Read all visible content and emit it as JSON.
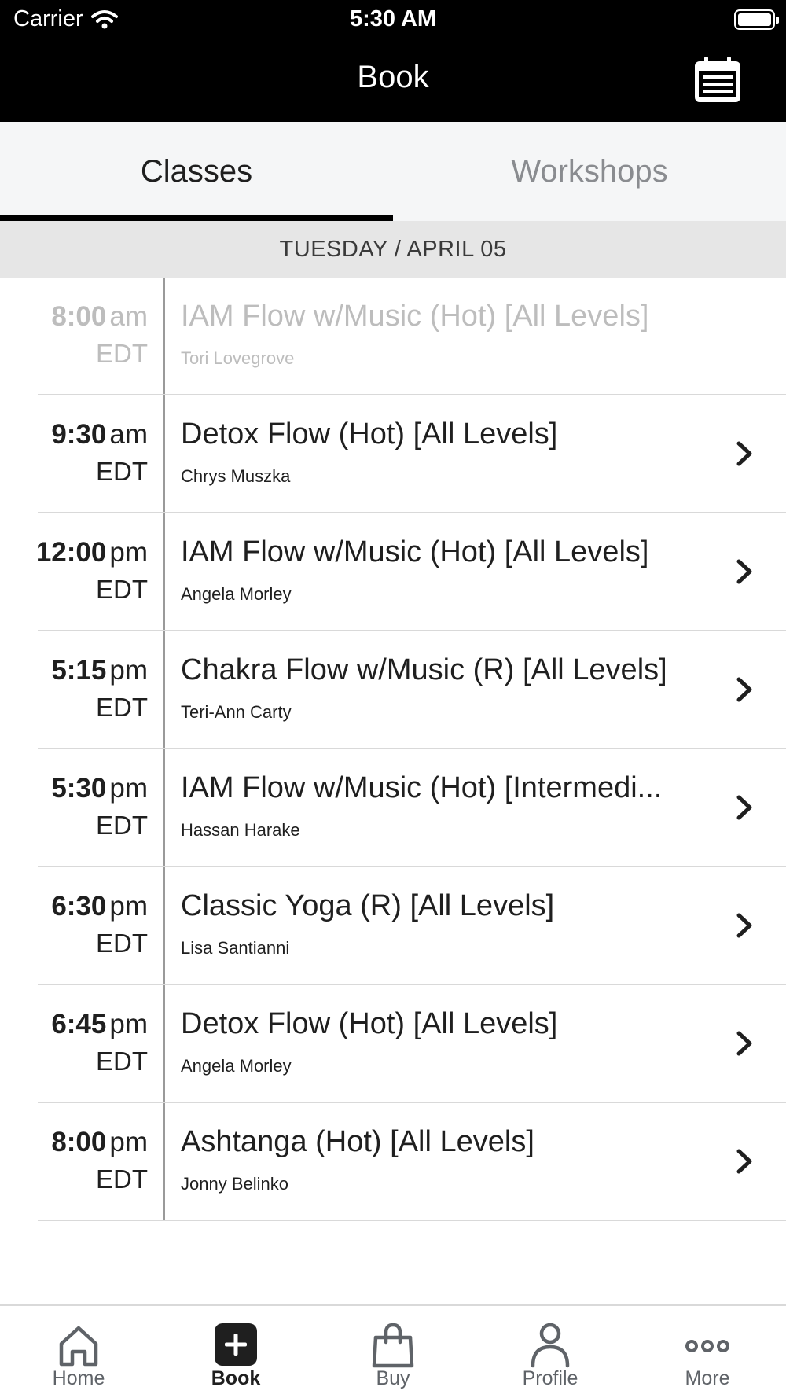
{
  "status": {
    "carrier": "Carrier",
    "time": "5:30 AM"
  },
  "header": {
    "title": "Book",
    "calendar_icon": "calendar-icon"
  },
  "tabs": [
    {
      "label": "Classes",
      "active": true
    },
    {
      "label": "Workshops",
      "active": false
    }
  ],
  "date_heading": "TUESDAY / APRIL 05",
  "classes": [
    {
      "time": "8:00",
      "ampm": "am",
      "tz": "EDT",
      "name": "IAM Flow w/Music (Hot) [All Levels]",
      "instructor": "Tori Lovegrove",
      "past": true
    },
    {
      "time": "9:30",
      "ampm": "am",
      "tz": "EDT",
      "name": "Detox Flow (Hot) [All Levels]",
      "instructor": "Chrys Muszka",
      "past": false
    },
    {
      "time": "12:00",
      "ampm": "pm",
      "tz": "EDT",
      "name": "IAM Flow w/Music (Hot) [All Levels]",
      "instructor": "Angela Morley",
      "past": false
    },
    {
      "time": "5:15",
      "ampm": "pm",
      "tz": "EDT",
      "name": "Chakra Flow w/Music (R) [All Levels]",
      "instructor": "Teri-Ann Carty",
      "past": false
    },
    {
      "time": "5:30",
      "ampm": "pm",
      "tz": "EDT",
      "name": "IAM Flow w/Music (Hot) [Intermedi...",
      "instructor": "Hassan Harake",
      "past": false
    },
    {
      "time": "6:30",
      "ampm": "pm",
      "tz": "EDT",
      "name": "Classic Yoga (R) [All Levels]",
      "instructor": "Lisa Santianni",
      "past": false
    },
    {
      "time": "6:45",
      "ampm": "pm",
      "tz": "EDT",
      "name": "Detox Flow (Hot) [All Levels]",
      "instructor": "Angela Morley",
      "past": false
    },
    {
      "time": "8:00",
      "ampm": "pm",
      "tz": "EDT",
      "name": "Ashtanga (Hot) [All Levels]",
      "instructor": "Jonny Belinko",
      "past": false
    }
  ],
  "tabbar": [
    {
      "label": "Home",
      "icon": "home-icon",
      "active": false
    },
    {
      "label": "Book",
      "icon": "plus-square-icon",
      "active": true
    },
    {
      "label": "Buy",
      "icon": "shopping-bag-icon",
      "active": false
    },
    {
      "label": "Profile",
      "icon": "person-icon",
      "active": false
    },
    {
      "label": "More",
      "icon": "more-dots-icon",
      "active": false
    }
  ]
}
